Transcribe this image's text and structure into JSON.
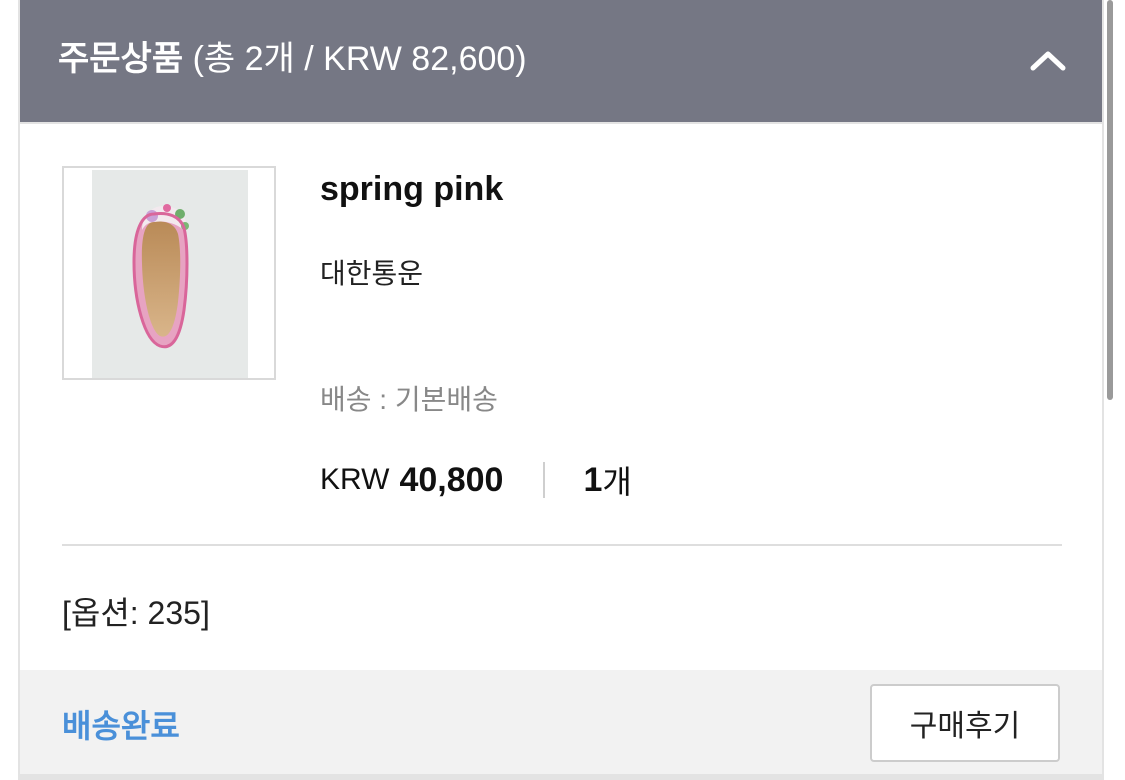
{
  "order_items": {
    "header": {
      "title": "주문상품",
      "summary": "(총 2개 / KRW 82,600)",
      "toggle_icon": "chevron-up-icon"
    },
    "product": {
      "image_alt": "pink floral flat shoe",
      "name": "spring pink",
      "brand": "대한통운",
      "shipping": "배송 : 기본배송",
      "currency": "KRW",
      "price": "40,800",
      "quantity": "1",
      "quantity_unit": "개"
    },
    "option": "[옵션: 235]",
    "footer": {
      "status": "배송완료",
      "review_button": "구매후기"
    }
  },
  "colors": {
    "header_bg": "#757784",
    "status_blue": "#4a90d9",
    "footer_bg": "#f2f2f2"
  }
}
